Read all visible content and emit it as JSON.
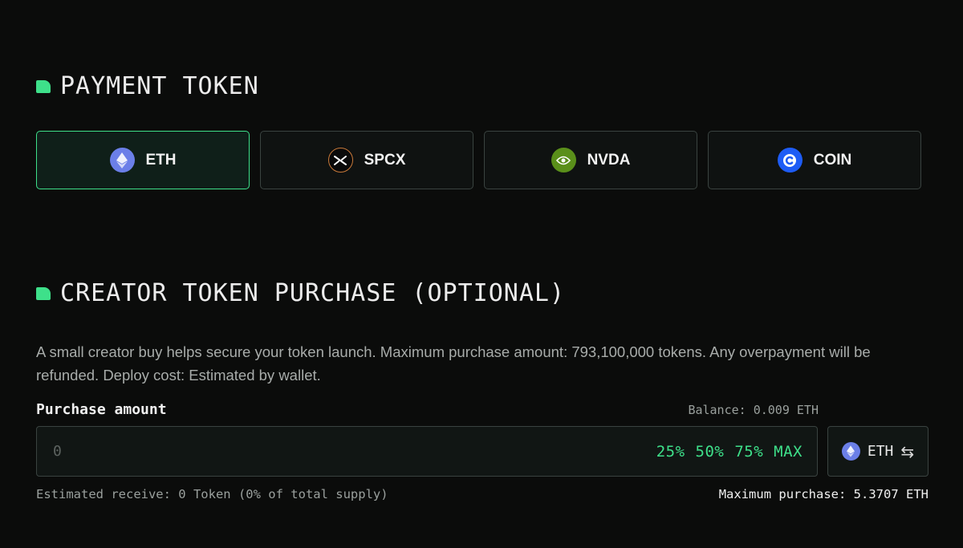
{
  "payment_section": {
    "title": "PAYMENT TOKEN",
    "tokens": [
      {
        "label": "ETH",
        "icon": "ethereum-icon",
        "selected": true
      },
      {
        "label": "SPCX",
        "icon": "spacex-icon",
        "selected": false
      },
      {
        "label": "NVDA",
        "icon": "nvidia-icon",
        "selected": false
      },
      {
        "label": "COIN",
        "icon": "coinbase-icon",
        "selected": false
      }
    ]
  },
  "creator_section": {
    "title": "CREATOR TOKEN PURCHASE (OPTIONAL)",
    "description": "A small creator buy helps secure your token launch. Maximum purchase amount: 793,100,000 tokens. Any overpayment will be refunded. Deploy cost: Estimated by wallet.",
    "purchase_label": "Purchase amount",
    "balance": "Balance: 0.009 ETH",
    "amount_placeholder": "0",
    "percent_buttons": [
      "25%",
      "50%",
      "75%",
      "MAX"
    ],
    "currency": "ETH",
    "estimated_receive": "Estimated receive: 0 Token (0% of total supply)",
    "maximum_purchase": "Maximum purchase: 5.3707 ETH"
  },
  "colors": {
    "accent": "#3ee08a",
    "background": "#0b0c0b",
    "border": "#3a4340"
  }
}
